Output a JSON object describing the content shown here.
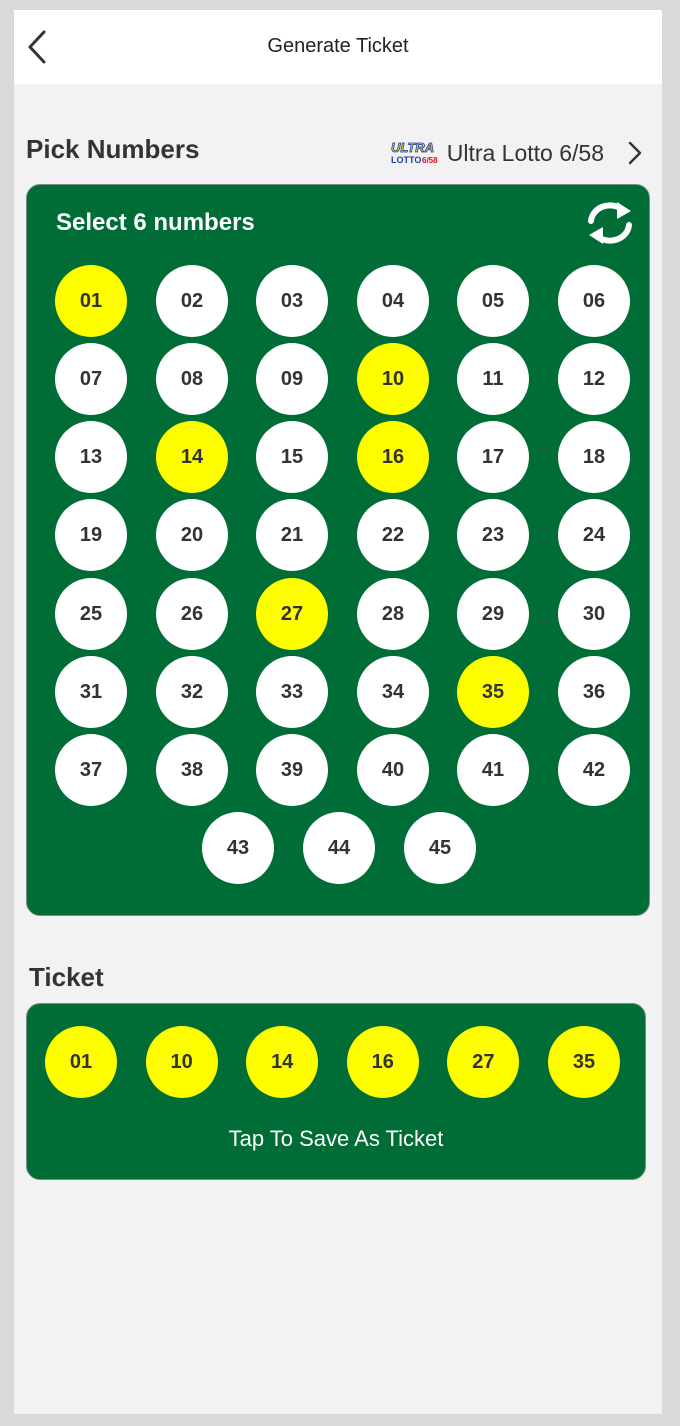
{
  "header": {
    "title": "Generate Ticket",
    "back_icon": "chevron-left-icon"
  },
  "pick": {
    "section_title": "Pick Numbers",
    "game": {
      "logo_top": "ULTRA",
      "logo_bottom": "LOTTO",
      "logo_suffix": "6/58",
      "name": "Ultra Lotto 6/58",
      "chevron_icon": "chevron-right-icon"
    },
    "instruction": "Select 6 numbers",
    "refresh_icon": "refresh-icon",
    "numbers": [
      "01",
      "02",
      "03",
      "04",
      "05",
      "06",
      "07",
      "08",
      "09",
      "10",
      "11",
      "12",
      "13",
      "14",
      "15",
      "16",
      "17",
      "18",
      "19",
      "20",
      "21",
      "22",
      "23",
      "24",
      "25",
      "26",
      "27",
      "28",
      "29",
      "30",
      "31",
      "32",
      "33",
      "34",
      "35",
      "36",
      "37",
      "38",
      "39",
      "40",
      "41",
      "42",
      "43",
      "44",
      "45"
    ],
    "selected": [
      "01",
      "10",
      "14",
      "16",
      "27",
      "35"
    ]
  },
  "ticket": {
    "section_title": "Ticket",
    "numbers": [
      "01",
      "10",
      "14",
      "16",
      "27",
      "35"
    ],
    "action_label": "Tap To Save As Ticket"
  },
  "colors": {
    "panel_green": "#016d36",
    "selected_yellow": "#fefe00",
    "ball_white": "#ffffff"
  }
}
